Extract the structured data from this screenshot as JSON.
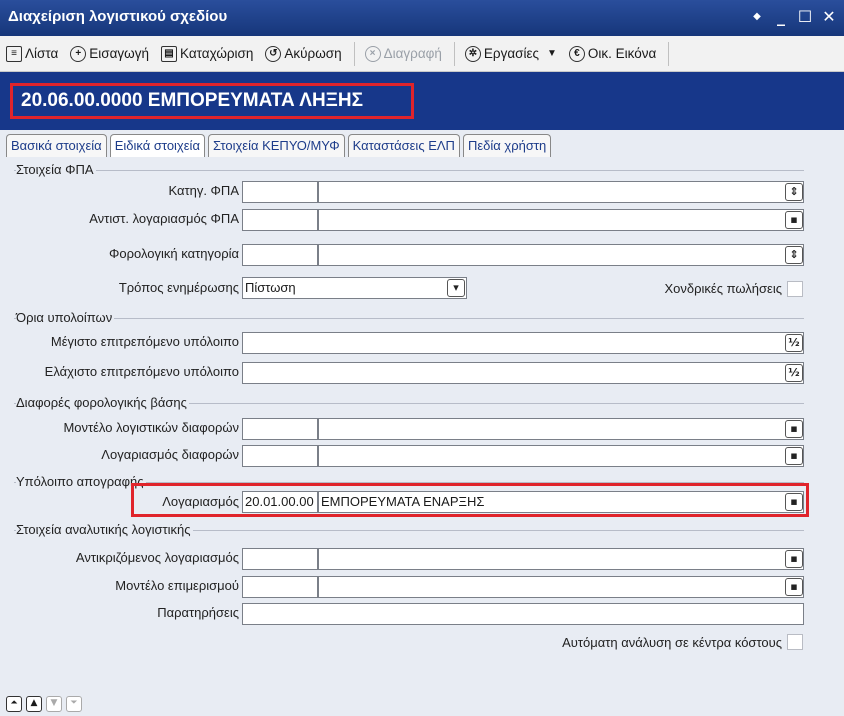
{
  "window": {
    "title": "Διαχείριση λογιστικού σχεδίου",
    "controls": [
      "◆",
      "_",
      "☐",
      "✕"
    ]
  },
  "toolbar": {
    "list": "Λίστα",
    "insert": "Εισαγωγή",
    "save": "Καταχώριση",
    "cancel": "Ακύρωση",
    "delete": "Διαγραφή",
    "tasks": "Εργασίες",
    "tasks_arrow": "▼",
    "financial": "Οικ. Εικόνα"
  },
  "account": {
    "title": "20.06.00.0000 ΕΜΠΟΡΕΥΜΑΤΑ ΛΗΞΗΣ"
  },
  "tabs": [
    "Βασικά στοιχεία",
    "Ειδικά στοιχεία",
    "Στοιχεία ΚΕΠΥΟ/ΜΥΦ",
    "Καταστάσεις ΕΛΠ",
    "Πεδία χρήστη"
  ],
  "sections": {
    "vat": "Στοιχεία ΦΠΑ",
    "limits": "Όρια υπολοίπων",
    "tax_diff": "Διαφορές φορολογικής βάσης",
    "inventory": "Υπόλοιπο απογραφής",
    "analytic": "Στοιχεία αναλυτικής λογιστικής"
  },
  "fields": {
    "vat_category": {
      "label": "Κατηγ. ΦΠΑ",
      "code": "",
      "name": ""
    },
    "vat_account": {
      "label": "Αντιστ. λογαριασμός ΦΠΑ",
      "code": "",
      "name": ""
    },
    "tax_category": {
      "label": "Φορολογική κατηγορία",
      "code": "",
      "name": ""
    },
    "update_method": {
      "label": "Τρόπος ενημέρωσης",
      "value": "Πίστωση"
    },
    "wholesale": {
      "label": "Χονδρικές πωλήσεις"
    },
    "max_balance": {
      "label": "Μέγιστο επιτρεπόμενο υπόλοιπο",
      "value": ""
    },
    "min_balance": {
      "label": "Ελάχιστο επιτρεπόμενο υπόλοιπο",
      "value": ""
    },
    "diff_model": {
      "label": "Μοντέλο λογιστικών διαφορών",
      "code": "",
      "name": ""
    },
    "diff_account": {
      "label": "Λογαριασμός διαφορών",
      "code": "",
      "name": ""
    },
    "inv_account": {
      "label": "Λογαριασμός",
      "code": "20.01.00.00",
      "name": "ΕΜΠΟΡΕΥΜΑΤΑ ΕΝΑΡΞΗΣ"
    },
    "counter_account": {
      "label": "Αντικριζόμενος λογαριασμός",
      "code": "",
      "name": ""
    },
    "allocation_model": {
      "label": "Μοντέλο επιμερισμού",
      "code": "",
      "name": ""
    },
    "notes": {
      "label": "Παρατηρήσεις",
      "value": ""
    },
    "auto_cost": {
      "label": "Αυτόματη ανάλυση σε κέντρα κόστους"
    }
  },
  "button_glyphs": {
    "select": "⇕",
    "lookup": "▪",
    "percent": "½",
    "dropdown": "▾"
  },
  "colors": {
    "title_bar": "#16367a",
    "header": "#17378a",
    "highlight": "#e0242b"
  }
}
